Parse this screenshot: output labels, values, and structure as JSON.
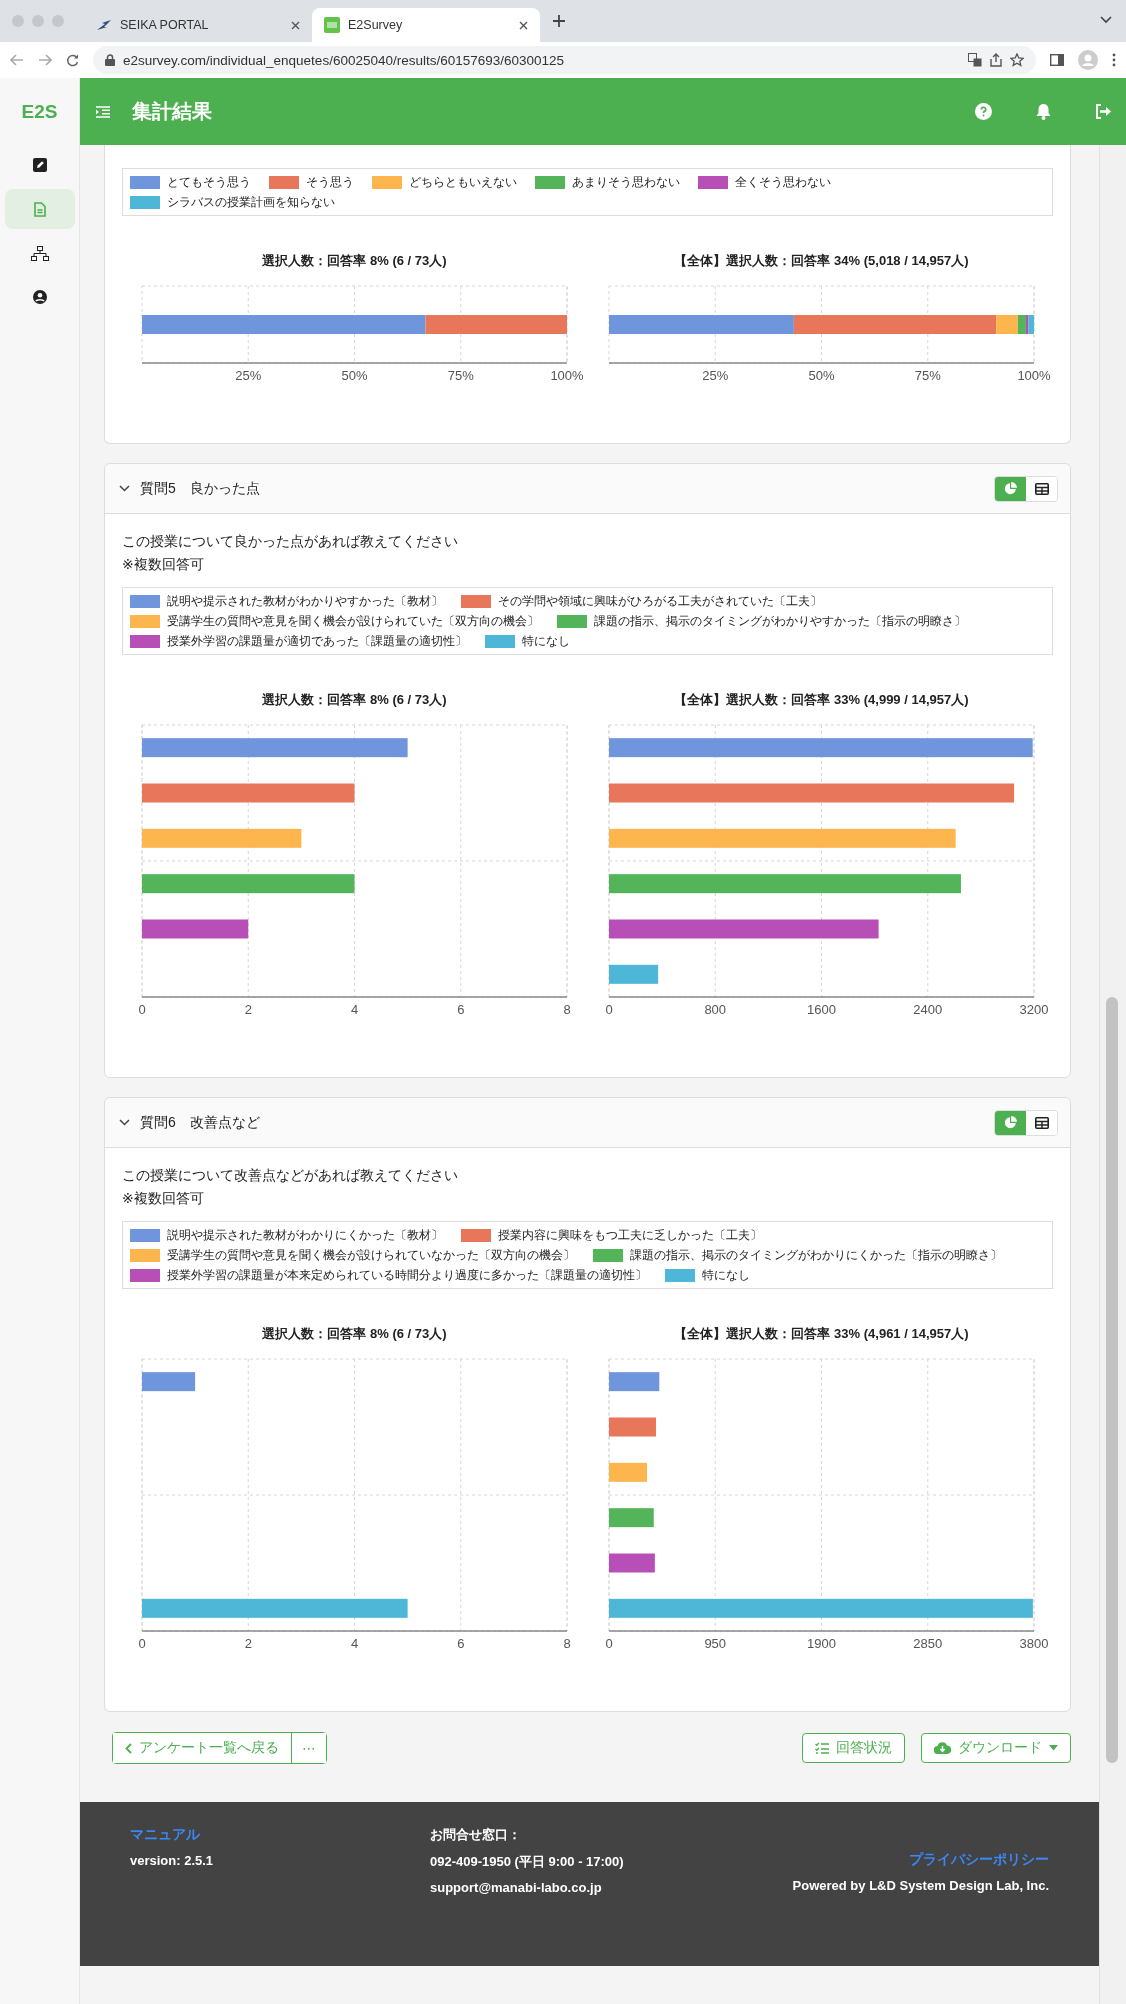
{
  "browser": {
    "tabs": [
      {
        "title": "SEIKA PORTAL",
        "selected": false
      },
      {
        "title": "E2Survey",
        "selected": true
      }
    ],
    "url": "e2survey.com/individual_enquetes/60025040/results/60157693/60300125"
  },
  "sidebar": {
    "logo": "E2S",
    "items": [
      {
        "kind": "edit",
        "selected": false
      },
      {
        "kind": "document",
        "selected": true
      },
      {
        "kind": "hierarchy",
        "selected": false
      },
      {
        "kind": "account",
        "selected": false
      }
    ]
  },
  "header": {
    "title": "集計結果"
  },
  "questions": [
    {
      "legend": [
        {
          "label": "とてもそう思う",
          "color": "#6f95dc"
        },
        {
          "label": "そう思う",
          "color": "#e8765b"
        },
        {
          "label": "どちらともいえない",
          "color": "#fdb64e"
        },
        {
          "label": "あまりそう思わない",
          "color": "#54b45a"
        },
        {
          "label": "全くそう思わない",
          "color": "#b74fb6"
        },
        {
          "label": "シラバスの授業計画を知らない",
          "color": "#4eb6d6"
        }
      ],
      "charts": [
        {
          "title": "選択人数：回答率 8% (6 / 73人)",
          "chart_data": {
            "type": "bar",
            "orientation": "horizontal",
            "stacked": true,
            "grid": true,
            "categories": [
              null
            ],
            "series": [
              {
                "values": [
                  66.7
                ]
              },
              {
                "values": [
                  33.3
                ]
              },
              {
                "values": [
                  0
                ]
              },
              {
                "values": [
                  0
                ]
              },
              {
                "values": [
                  0
                ]
              },
              {
                "values": [
                  0
                ]
              }
            ],
            "xlim": [
              0,
              100
            ],
            "xticks": [
              {
                "value": 25,
                "label": "25%"
              },
              {
                "value": 50,
                "label": "50%"
              },
              {
                "value": 75,
                "label": "75%"
              },
              {
                "value": 100,
                "label": "100%"
              }
            ]
          }
        },
        {
          "title": "【全体】選択人数：回答率 34% (5,018 / 14,957人)",
          "chart_data": {
            "type": "bar",
            "orientation": "horizontal",
            "stacked": true,
            "grid": true,
            "categories": [
              null
            ],
            "series": [
              {
                "values": [
                  43.5
                ]
              },
              {
                "values": [
                  47.6
                ]
              },
              {
                "values": [
                  5.1
                ]
              },
              {
                "values": [
                  1.9
                ]
              },
              {
                "values": [
                  0.6
                ]
              },
              {
                "values": [
                  1.3
                ]
              }
            ],
            "xlim": [
              0,
              100
            ],
            "xticks": [
              {
                "value": 25,
                "label": "25%"
              },
              {
                "value": 50,
                "label": "50%"
              },
              {
                "value": 75,
                "label": "75%"
              },
              {
                "value": 100,
                "label": "100%"
              }
            ]
          }
        }
      ]
    },
    {
      "title": "質問5　良かった点",
      "view_toggle": [
        {
          "kind": "chart",
          "selected": true
        },
        {
          "kind": "table",
          "selected": false
        }
      ],
      "text": "この授業について良かった点があれば教えてください",
      "note": "※複数回答可",
      "legend": [
        {
          "label": "説明や提示された教材がわかりやすかった〔教材〕",
          "color": "#6f95dc"
        },
        {
          "label": "その学問や領域に興味がひろがる工夫がされていた〔工夫〕",
          "color": "#e8765b"
        },
        {
          "label": "受講学生の質問や意見を聞く機会が設けられていた〔双方向の機会〕",
          "color": "#fdb64e"
        },
        {
          "label": "課題の指示、掲示のタイミングがわかりやすかった〔指示の明瞭さ〕",
          "color": "#54b45a"
        },
        {
          "label": "授業外学習の課題量が適切であった〔課題量の適切性〕",
          "color": "#b74fb6"
        },
        {
          "label": "特になし",
          "color": "#4eb6d6"
        }
      ],
      "charts": [
        {
          "title": "選択人数：回答率 8% (6 / 73人)",
          "chart_data": {
            "type": "bar",
            "orientation": "horizontal",
            "grid": true,
            "categories": [
              null,
              null,
              null,
              null,
              null,
              null
            ],
            "values": [
              5,
              4,
              3,
              4,
              2,
              0
            ],
            "xlim": [
              0,
              8
            ],
            "xticks": [
              0,
              2,
              4,
              6,
              8
            ]
          }
        },
        {
          "title": "【全体】選択人数：回答率 33% (4,999 / 14,957人)",
          "chart_data": {
            "type": "bar",
            "orientation": "horizontal",
            "grid": true,
            "categories": [
              null,
              null,
              null,
              null,
              null,
              null
            ],
            "values": [
              3190,
              3050,
              2610,
              2650,
              2030,
              370
            ],
            "xlim": [
              0,
              3200
            ],
            "xticks": [
              0,
              800,
              1600,
              2400,
              3200
            ]
          }
        }
      ]
    },
    {
      "title": "質問6　改善点など",
      "view_toggle": [
        {
          "kind": "chart",
          "selected": true
        },
        {
          "kind": "table",
          "selected": false
        }
      ],
      "text": "この授業について改善点などがあれば教えてください",
      "note": "※複数回答可",
      "legend": [
        {
          "label": "説明や提示された教材がわかりにくかった〔教材〕",
          "color": "#6f95dc"
        },
        {
          "label": "授業内容に興味をもつ工夫に乏しかった〔工夫〕",
          "color": "#e8765b"
        },
        {
          "label": "受講学生の質問や意見を聞く機会が設けられていなかった〔双方向の機会〕",
          "color": "#fdb64e"
        },
        {
          "label": "課題の指示、掲示のタイミングがわかりにくかった〔指示の明瞭さ〕",
          "color": "#54b45a"
        },
        {
          "label": "授業外学習の課題量が本来定められている時間分より過度に多かった〔課題量の適切性〕",
          "color": "#b74fb6"
        },
        {
          "label": "特になし",
          "color": "#4eb6d6"
        }
      ],
      "charts": [
        {
          "title": "選択人数：回答率 8% (6 / 73人)",
          "chart_data": {
            "type": "bar",
            "orientation": "horizontal",
            "grid": true,
            "categories": [
              null,
              null,
              null,
              null,
              null,
              null
            ],
            "values": [
              1,
              0,
              0,
              0,
              0,
              5
            ],
            "xlim": [
              0,
              8
            ],
            "xticks": [
              0,
              2,
              4,
              6,
              8
            ]
          }
        },
        {
          "title": "【全体】選択人数：回答率 33% (4,961 / 14,957人)",
          "chart_data": {
            "type": "bar",
            "orientation": "horizontal",
            "grid": true,
            "categories": [
              null,
              null,
              null,
              null,
              null,
              null
            ],
            "values": [
              450,
              420,
              340,
              400,
              410,
              3790
            ],
            "xlim": [
              0,
              3800
            ],
            "xticks": [
              0,
              950,
              1900,
              2850,
              3800
            ]
          }
        }
      ]
    }
  ],
  "actions": {
    "back": "アンケート一覧へ戻る",
    "more": "⋯",
    "status": "回答状況",
    "download": "ダウンロード"
  },
  "footer": {
    "manual": "マニュアル",
    "version": "version: 2.5.1",
    "contact_label": "お問合せ窓口：",
    "phone": "092-409-1950 (平日 9:00 - 17:00)",
    "email": "support@manabi-labo.co.jp",
    "privacy": "プライバシーポリシー",
    "powered": "Powered by L&D System Design Lab, Inc."
  }
}
